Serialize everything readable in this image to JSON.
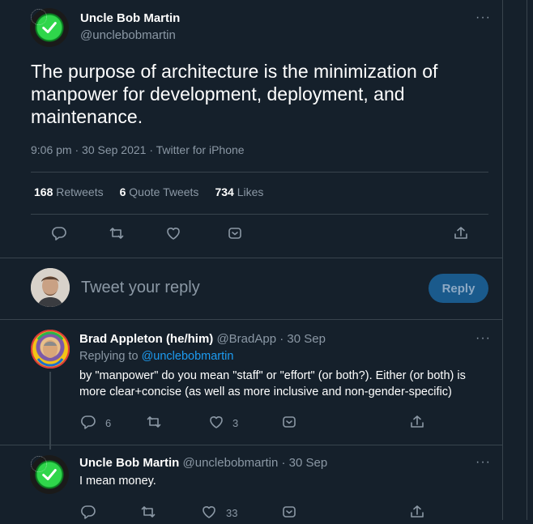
{
  "main_tweet": {
    "author_name": "Uncle Bob Martin",
    "author_handle": "@unclebobmartin",
    "text": "The purpose of architecture is the minimization of manpower for development, deployment, and maintenance.",
    "meta": "9:06 pm · 30 Sep 2021 · Twitter for iPhone",
    "stats": {
      "retweets_count": "168",
      "retweets_label": "Retweets",
      "quotes_count": "6",
      "quotes_label": "Quote Tweets",
      "likes_count": "734",
      "likes_label": "Likes"
    },
    "more": "···"
  },
  "composer": {
    "placeholder": "Tweet your reply",
    "button": "Reply"
  },
  "replies": [
    {
      "name": "Brad Appleton (he/him)",
      "handle_time": "@BradApp · 30 Sep",
      "replying_prefix": "Replying to ",
      "replying_to": "@unclebobmartin",
      "text": "by \"manpower\" do you mean \"staff\" or \"effort\" (or both?). Either (or both) is more clear+concise (as well as more inclusive and non-gender-specific)",
      "reply_count": "6",
      "retweet_count": "",
      "like_count": "3",
      "more": "···"
    },
    {
      "name": "Uncle Bob Martin",
      "handle_time": "@unclebobmartin · 30 Sep",
      "text": "I mean money.",
      "reply_count": "",
      "retweet_count": "",
      "like_count": "33",
      "more": "···"
    }
  ],
  "colors": {
    "background": "#15202b",
    "divider": "#38444d",
    "muted": "#8b98a5",
    "link": "#1d9bf0",
    "reply_button": "#1a5a8c"
  },
  "icons": [
    "reply-icon",
    "retweet-icon",
    "like-icon",
    "bookmark-icon",
    "share-icon",
    "more-icon"
  ]
}
